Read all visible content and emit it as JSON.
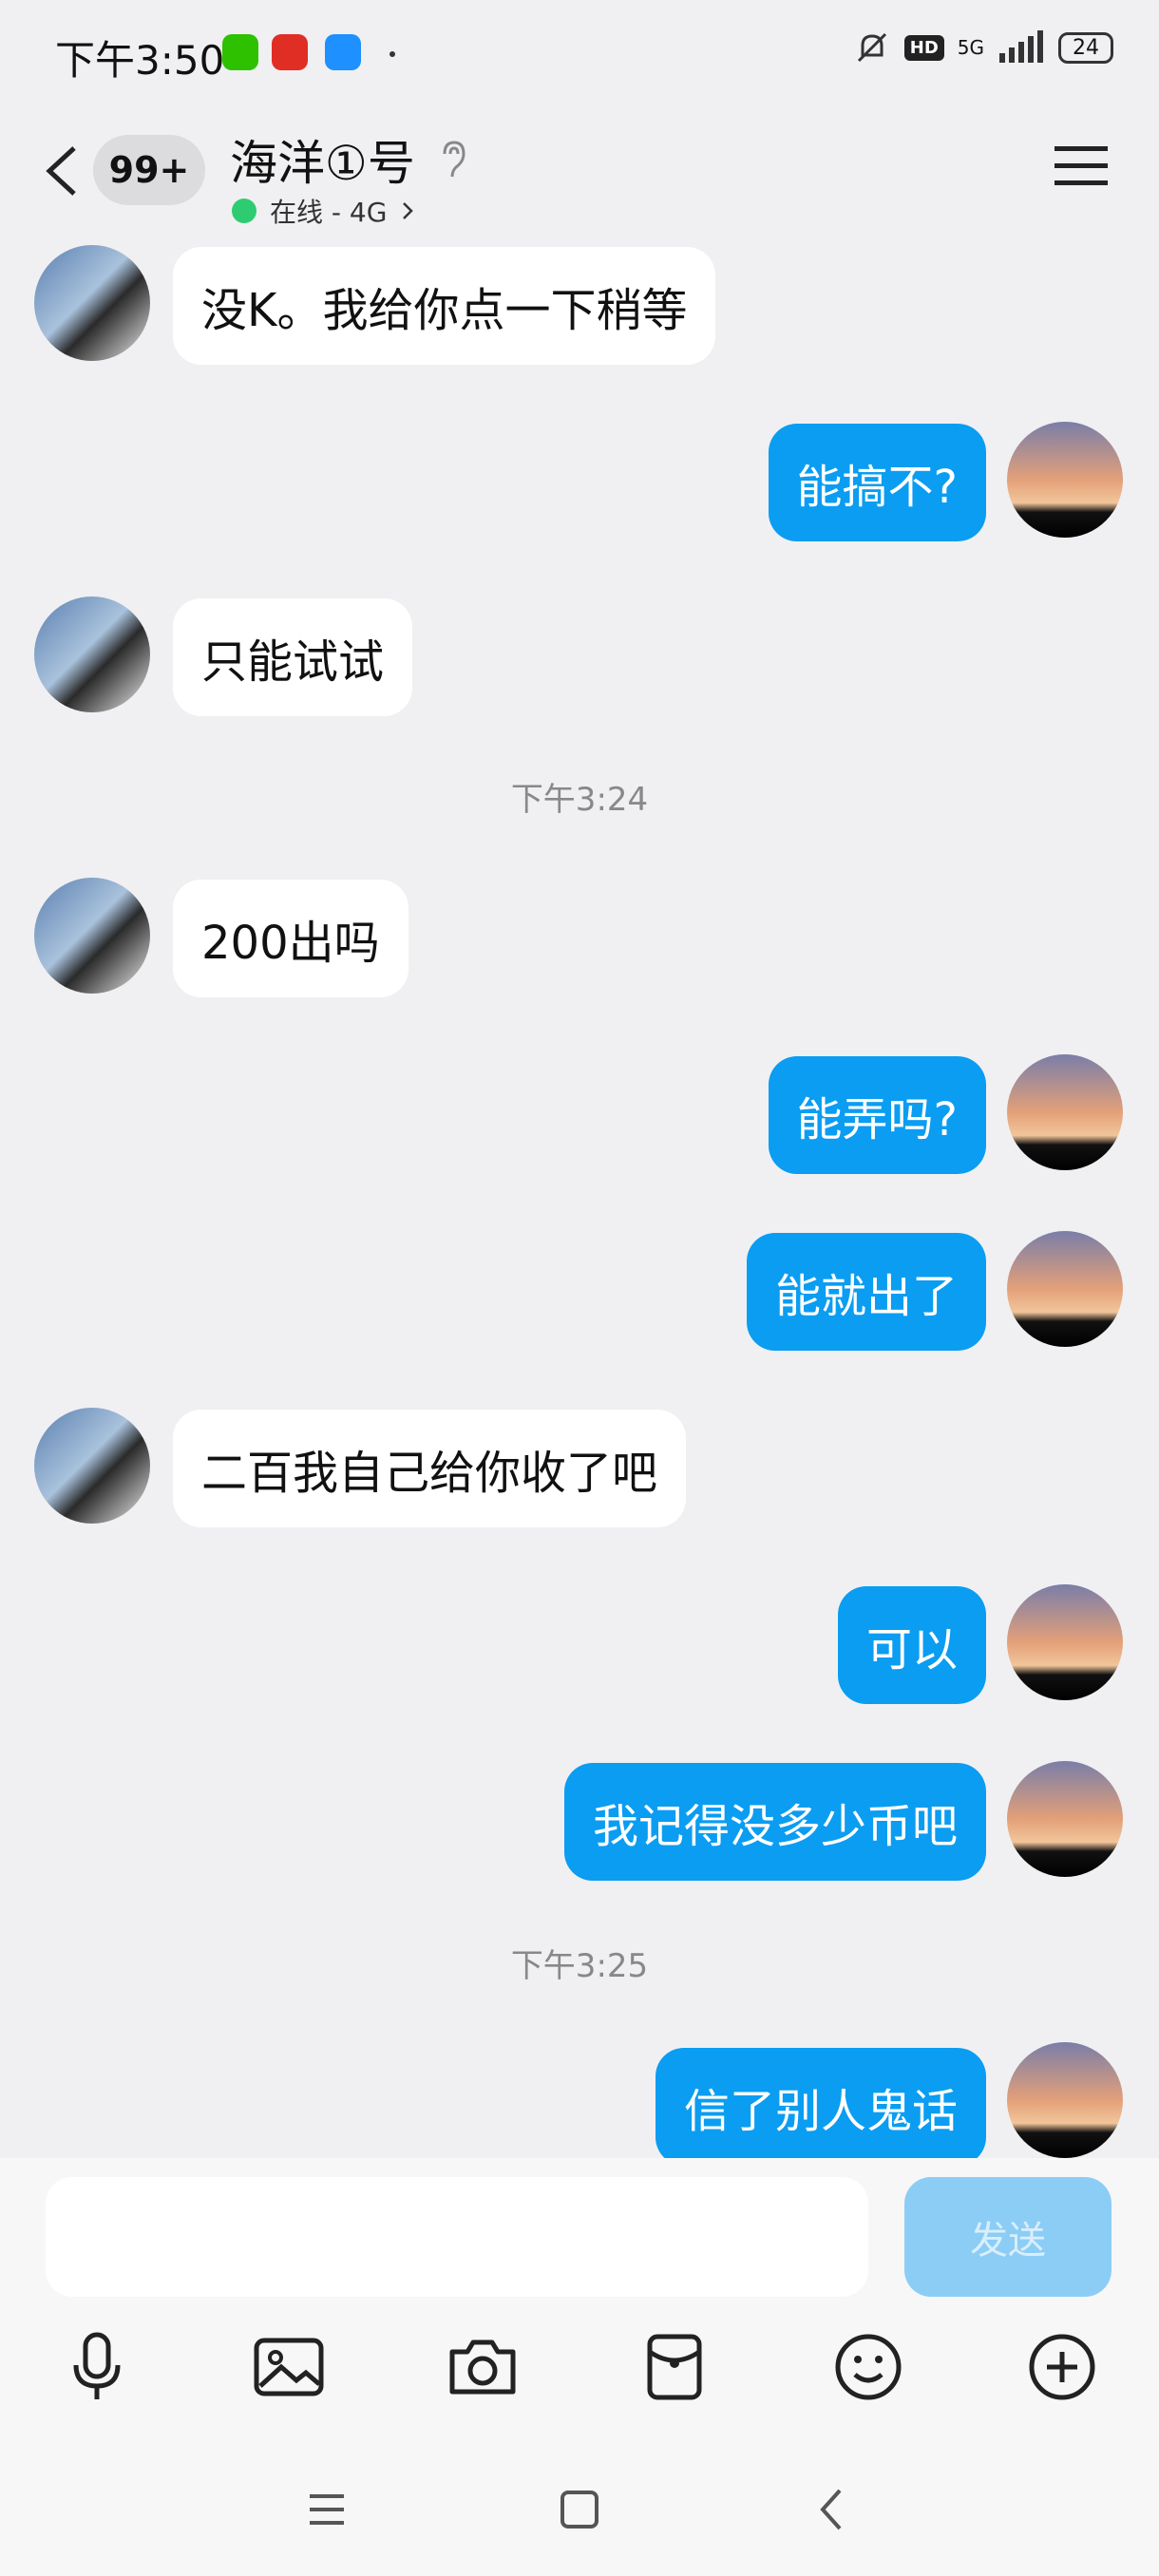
{
  "status_bar": {
    "time": "下午3:50",
    "signal": "5G",
    "battery": "24"
  },
  "header": {
    "unread_count": "99+",
    "title": "海洋①号",
    "online_status": "在线 - 4G"
  },
  "messages": [
    {
      "side": "left",
      "text": "没K。我给你点一下稍等"
    },
    {
      "side": "right",
      "text": "能搞不?"
    },
    {
      "side": "left",
      "text": "只能试试"
    },
    {
      "side": "time",
      "text": "下午3:24"
    },
    {
      "side": "left",
      "text": "200出吗"
    },
    {
      "side": "right",
      "text": "能弄吗?"
    },
    {
      "side": "right",
      "text": "能就出了"
    },
    {
      "side": "left",
      "text": "二百我自己给你收了吧"
    },
    {
      "side": "right",
      "text": "可以"
    },
    {
      "side": "right",
      "text": "我记得没多少币吧"
    },
    {
      "side": "time",
      "text": "下午3:25"
    },
    {
      "side": "right",
      "text": "信了别人鬼话"
    }
  ],
  "composer": {
    "input_value": "",
    "send_label": "发送"
  },
  "icons": [
    "microphone-icon",
    "image-icon",
    "camera-icon",
    "red-packet-icon",
    "emoji-icon",
    "plus-icon"
  ],
  "colors": {
    "sent_bubble": "#0a9df2",
    "received_bubble": "#ffffff",
    "background": "#f0f0f2",
    "online_dot": "#2ecc71"
  }
}
